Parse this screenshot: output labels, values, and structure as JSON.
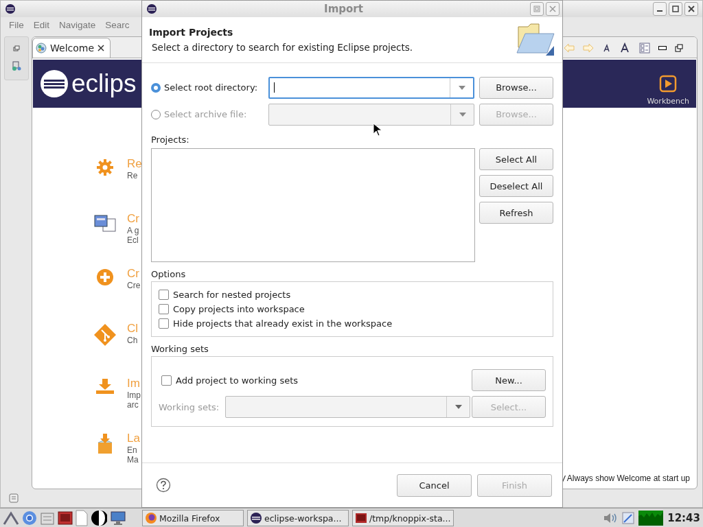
{
  "main_window": {
    "menu": [
      {
        "label": "File"
      },
      {
        "label": "Edit"
      },
      {
        "label": "Navigate"
      },
      {
        "label": "Searc"
      }
    ],
    "tab": {
      "label": "Welcome"
    },
    "logo_text": "eclips",
    "workbench_label": "Workbench",
    "welcome_items": [
      {
        "kind": "gear",
        "title": "Re",
        "lines": [
          "Re"
        ]
      },
      {
        "kind": "notes",
        "title": "Cr",
        "lines": [
          "A g",
          "Ecl"
        ]
      },
      {
        "kind": "plus",
        "title": "Cr",
        "lines": [
          "Cre"
        ]
      },
      {
        "kind": "git",
        "title": "Cl",
        "lines": [
          "Ch"
        ]
      },
      {
        "kind": "download",
        "title": "Im",
        "lines": [
          "Imp",
          "arc"
        ]
      },
      {
        "kind": "box",
        "title": "La",
        "lines": [
          "En",
          "Ma"
        ]
      }
    ],
    "always_show": {
      "label": "Always show Welcome at start up",
      "checked": true
    }
  },
  "dialog": {
    "title": "Import",
    "heading": "Import Projects",
    "description": "Select a directory to search for existing Eclipse projects.",
    "sources": [
      {
        "label": "Select root directory:",
        "selected": true,
        "disabled": false,
        "focused": true,
        "browse": "Browse..."
      },
      {
        "label": "Select archive file:",
        "selected": false,
        "disabled": true,
        "focused": false,
        "browse": "Browse..."
      }
    ],
    "projects_label": "Projects:",
    "project_buttons": [
      "Select All",
      "Deselect All",
      "Refresh"
    ],
    "options": {
      "title": "Options",
      "items": [
        {
          "label": "Search for nested projects",
          "checked": false
        },
        {
          "label": "Copy projects into workspace",
          "checked": false
        },
        {
          "label": "Hide projects that already exist in the workspace",
          "checked": false
        }
      ]
    },
    "working_sets": {
      "title": "Working sets",
      "add": {
        "label": "Add project to working sets",
        "checked": false
      },
      "new_button": "New...",
      "field_label": "Working sets:",
      "select_button": "Select...",
      "disabled": true
    },
    "buttons": [
      {
        "label": "Cancel",
        "disabled": false
      },
      {
        "label": "Finish",
        "disabled": true
      }
    ]
  },
  "taskbar": {
    "tasks": [
      {
        "kind": "firefox",
        "label": "Mozilla Firefox"
      },
      {
        "kind": "eclipse",
        "label": "eclipse-workspa..."
      },
      {
        "kind": "terminal",
        "label": "/tmp/knoppix-sta..."
      }
    ],
    "clock": "12:43"
  }
}
